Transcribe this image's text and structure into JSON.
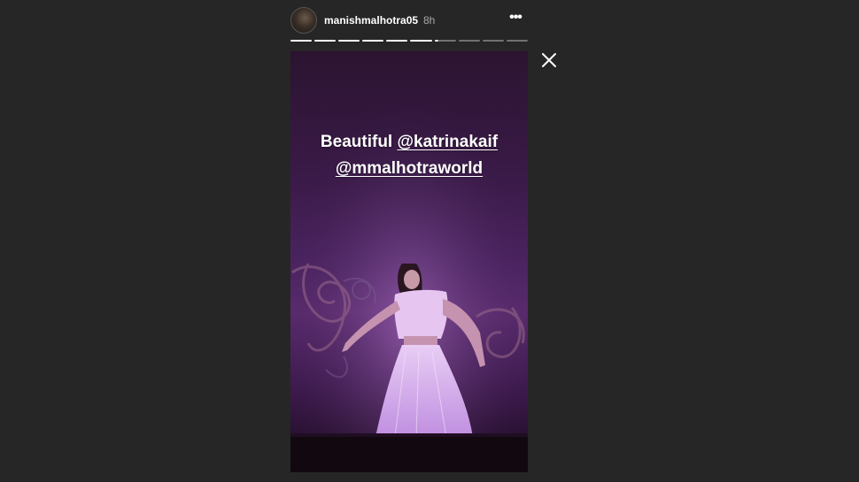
{
  "header": {
    "username": "manishmalhotra05",
    "time": "8h",
    "more_label": "•••"
  },
  "progress": {
    "segments_total": 10,
    "segments_done": 6,
    "current_fraction": 0.15
  },
  "story": {
    "caption_word": "Beautiful",
    "mention_1": "@katrinakaif",
    "mention_2": "@mmalhotraworld"
  },
  "icons": {
    "close": "close-icon",
    "more": "more-options-icon",
    "avatar": "avatar"
  }
}
